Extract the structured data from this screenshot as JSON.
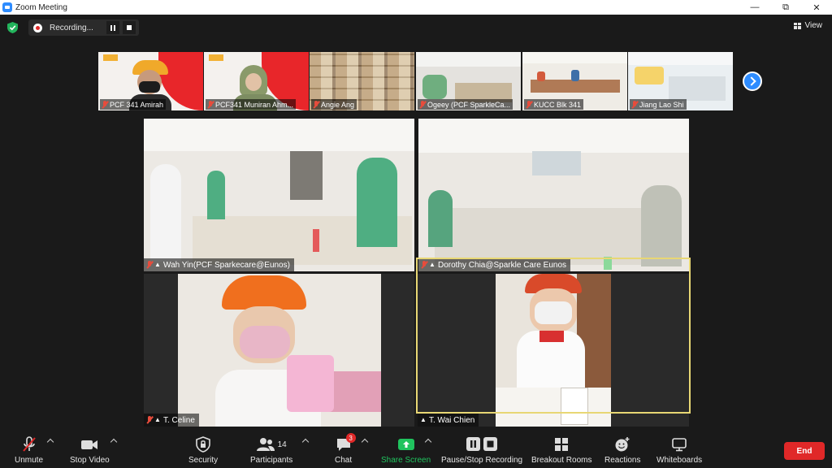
{
  "window": {
    "title": "Zoom Meeting"
  },
  "recording": {
    "status": "Recording..."
  },
  "view_button": {
    "label": "View"
  },
  "gallery_strip": [
    {
      "name": "PCF 341 Amirah"
    },
    {
      "name": "PCF341 Muniran Ahm..."
    },
    {
      "name": "Angie Ang"
    },
    {
      "name": "Ogeey (PCF SparkleCa..."
    },
    {
      "name": "KUCC Blk 341"
    },
    {
      "name": "Jiang Lao Shi"
    }
  ],
  "main_tiles": [
    {
      "name": "Wah Yin(PCF Sparkecare@Eunos)"
    },
    {
      "name": "Dorothy Chia@Sparkle Care Eunos"
    },
    {
      "name": "T. Celine"
    },
    {
      "name": "T. Wai Chien"
    }
  ],
  "toolbar": {
    "unmute": "Unmute",
    "stop_video": "Stop Video",
    "security": "Security",
    "participants": "Participants",
    "participants_count": "14",
    "chat": "Chat",
    "chat_badge": "3",
    "share_screen": "Share Screen",
    "pause_stop_recording": "Pause/Stop Recording",
    "breakout_rooms": "Breakout Rooms",
    "reactions": "Reactions",
    "whiteboards": "Whiteboards",
    "end": "End"
  },
  "colors": {
    "accent": "#2d8cff",
    "end_red": "#e02828",
    "share_green": "#20c35e",
    "active_speaker": "#e8d774"
  }
}
